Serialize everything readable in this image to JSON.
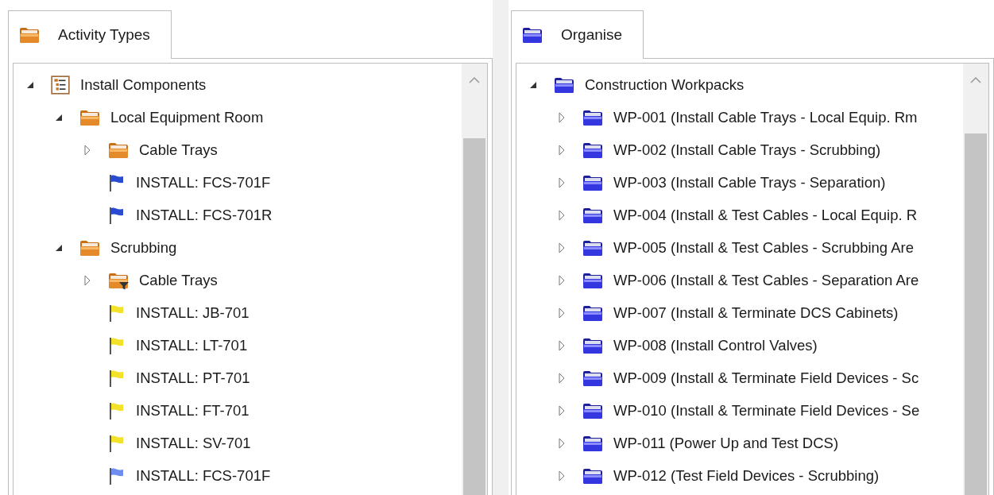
{
  "panels": [
    {
      "tab": {
        "label": "Activity Types",
        "kind": "folder-orange"
      },
      "tree": [
        {
          "label": "Install Components",
          "kind": "checklist",
          "expanded": true,
          "children": [
            {
              "label": "Local Equipment Room",
              "kind": "folder-orange",
              "expanded": true,
              "children": [
                {
                  "label": "Cable Trays",
                  "kind": "folder-orange",
                  "expanded": false
                },
                {
                  "label": "INSTALL: FCS-701F",
                  "kind": "flag",
                  "color": "#2a4bd0"
                },
                {
                  "label": "INSTALL: FCS-701R",
                  "kind": "flag",
                  "color": "#2a4bd0"
                }
              ]
            },
            {
              "label": "Scrubbing",
              "kind": "folder-orange",
              "expanded": true,
              "children": [
                {
                  "label": "Cable Trays",
                  "kind": "folder-filter",
                  "expanded": false
                },
                {
                  "label": "INSTALL: JB-701",
                  "kind": "flag",
                  "color": "#f2e22a"
                },
                {
                  "label": "INSTALL: LT-701",
                  "kind": "flag",
                  "color": "#f2e22a"
                },
                {
                  "label": "INSTALL: PT-701",
                  "kind": "flag",
                  "color": "#f2e22a"
                },
                {
                  "label": "INSTALL: FT-701",
                  "kind": "flag",
                  "color": "#f2e22a"
                },
                {
                  "label": "INSTALL: SV-701",
                  "kind": "flag",
                  "color": "#f2e22a"
                },
                {
                  "label": "INSTALL: FCS-701F",
                  "kind": "flag",
                  "color": "#6f8cf0"
                }
              ]
            }
          ]
        }
      ]
    },
    {
      "tab": {
        "label": "Organise",
        "kind": "folder-blue"
      },
      "tree": [
        {
          "label": "Construction Workpacks",
          "kind": "folder-blue",
          "expanded": true,
          "children": [
            {
              "label": "WP-001 (Install Cable Trays - Local Equip. Rm",
              "kind": "folder-blue",
              "expanded": false
            },
            {
              "label": "WP-002 (Install Cable Trays - Scrubbing)",
              "kind": "folder-blue",
              "expanded": false
            },
            {
              "label": "WP-003 (Install Cable Trays - Separation)",
              "kind": "folder-blue",
              "expanded": false
            },
            {
              "label": "WP-004 (Install & Test Cables - Local Equip. R",
              "kind": "folder-blue",
              "expanded": false
            },
            {
              "label": "WP-005 (Install & Test Cables - Scrubbing Are",
              "kind": "folder-blue",
              "expanded": false
            },
            {
              "label": "WP-006 (Install & Test Cables - Separation Are",
              "kind": "folder-blue",
              "expanded": false
            },
            {
              "label": "WP-007 (Install & Terminate DCS Cabinets)",
              "kind": "folder-blue",
              "expanded": false
            },
            {
              "label": "WP-008 (Install Control Valves)",
              "kind": "folder-blue",
              "expanded": false
            },
            {
              "label": "WP-009 (Install & Terminate Field Devices - Sc",
              "kind": "folder-blue",
              "expanded": false
            },
            {
              "label": "WP-010 (Install & Terminate Field Devices - Se",
              "kind": "folder-blue",
              "expanded": false
            },
            {
              "label": "WP-011 (Power Up and Test DCS)",
              "kind": "folder-blue",
              "expanded": false
            },
            {
              "label": "WP-012 (Test Field Devices - Scrubbing)",
              "kind": "folder-blue",
              "expanded": false
            }
          ]
        }
      ]
    }
  ]
}
